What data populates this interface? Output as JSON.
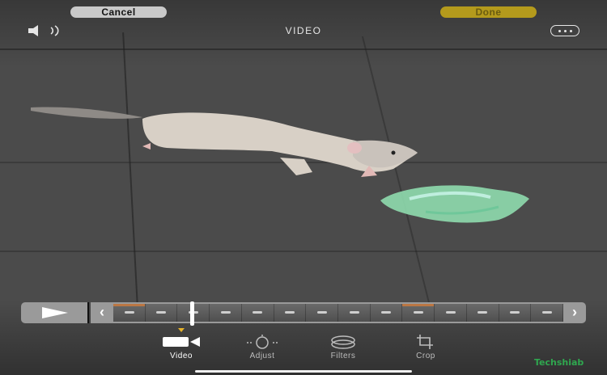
{
  "top_bar": {
    "cancel_label": "Cancel",
    "done_label": "Done",
    "mode_title": "VIDEO",
    "speaker_icon": "speaker-wave-icon",
    "more_icon": "ellipsis-circle-icon"
  },
  "scrubber": {
    "play_icon": "play-icon",
    "left_chevron": "‹",
    "right_chevron": "›",
    "thumbnail_count": 14,
    "playhead_position": 0.17
  },
  "toolbar": {
    "tools": [
      {
        "label": "Video",
        "icon": "video-camera-icon",
        "selected": true
      },
      {
        "label": "Adjust",
        "icon": "adjust-dial-icon",
        "selected": false
      },
      {
        "label": "Filters",
        "icon": "filters-icon",
        "selected": false
      },
      {
        "label": "Crop",
        "icon": "crop-icon",
        "selected": false
      }
    ]
  },
  "watermark": "Techshiab",
  "colors": {
    "accent": "#e7b32a",
    "done_bg": "#b49a1c",
    "cancel_bg": "#c9c9c9",
    "scrubber_frame": "#9a9a9a"
  }
}
